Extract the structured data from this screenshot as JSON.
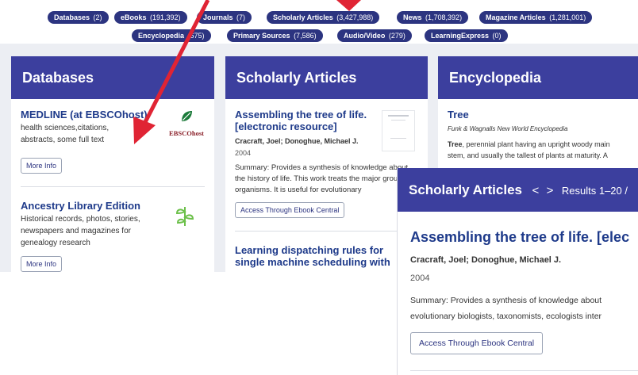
{
  "filters": [
    {
      "name": "Databases",
      "count": "(2)"
    },
    {
      "name": "eBooks",
      "count": "(191,392)"
    },
    {
      "name": "Journals",
      "count": "(7)"
    },
    {
      "name": "Scholarly Articles",
      "count": "(3,427,988)"
    },
    {
      "name": "News",
      "count": "(1,708,392)"
    },
    {
      "name": "Magazine Articles",
      "count": "(1,281,001)"
    },
    {
      "name": "Encyclopedia",
      "count": "(675)"
    },
    {
      "name": "Primary Sources",
      "count": "(7,586)"
    },
    {
      "name": "Audio/Video",
      "count": "(279)"
    },
    {
      "name": "LearningExpress",
      "count": "(0)"
    }
  ],
  "databases": {
    "header": "Databases",
    "items": [
      {
        "title": "MEDLINE (at EBSCOhost)",
        "description": "health sciences,citations, abstracts, some full text",
        "logo_text": "EBSCOhost",
        "button": "More Info"
      },
      {
        "title": "Ancestry Library Edition",
        "description": "Historical records, photos, stories, newspapers and magazines for genealogy research",
        "button": "More Info"
      }
    ]
  },
  "scholarly": {
    "header": "Scholarly Articles",
    "items": [
      {
        "title": "Assembling the tree of life. [electronic resource]",
        "author": "Cracraft, Joel; Donoghue, Michael J.",
        "year": "2004",
        "summary": "Summary: Provides a synthesis of knowledge about the history of life. This work treats the major groups of organisms. It is useful for evolutionary",
        "button": "Access Through Ebook Central"
      },
      {
        "title": "Learning dispatching rules for single machine scheduling with"
      }
    ]
  },
  "encyclopedia": {
    "header": "Encyclopedia",
    "items": [
      {
        "title": "Tree",
        "source": "Funk & Wagnalls New World Encyclopedia",
        "term": "Tree",
        "text": ", perennial plant having an upright woody main stem, and usually the tallest of plants at maturity. A"
      }
    ]
  },
  "zoom": {
    "header_title": "Scholarly Articles",
    "prev": "<",
    "next": ">",
    "results": "Results 1–20 /",
    "title": "Assembling the tree of life. [elec",
    "author": "Cracraft, Joel; Donoghue, Michael J.",
    "year": "2004",
    "summary_line1": "Summary: Provides a synthesis of knowledge about",
    "summary_line2": "evolutionary biologists, taxonomists, ecologists inter",
    "button": "Access Through Ebook Central"
  },
  "colors": {
    "header_bg": "#3c3f9e",
    "pill_bg": "#2c3480",
    "link": "#1e3a8a",
    "arrow": "#e02434"
  }
}
